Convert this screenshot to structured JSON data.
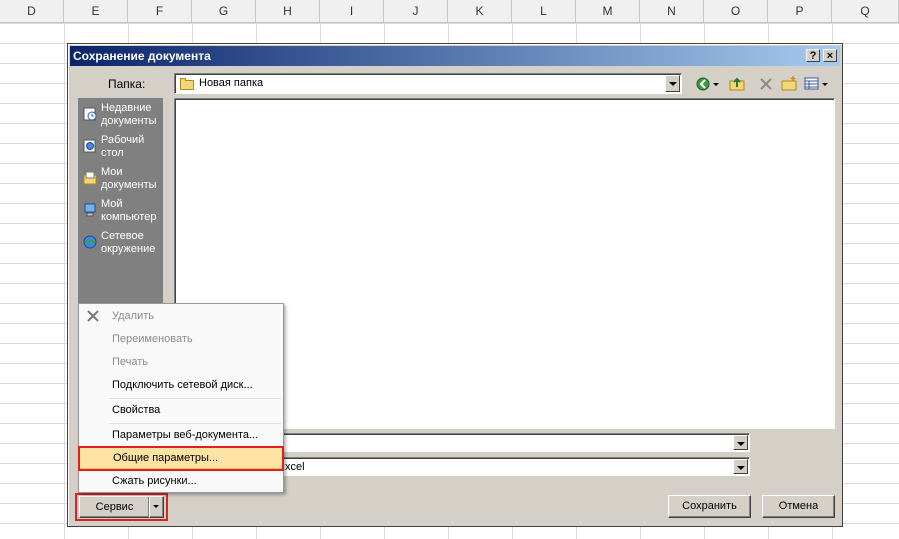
{
  "sheet": {
    "columns": [
      "D",
      "E",
      "F",
      "G",
      "H",
      "I",
      "J",
      "K",
      "L",
      "M",
      "N",
      "O",
      "P",
      "Q"
    ]
  },
  "dialog": {
    "title": "Сохранение документа",
    "help_label": "?",
    "close_label": "×",
    "folder_label": "Папка:",
    "folder_value": "Новая папка",
    "places": [
      {
        "label": "Недавние документы",
        "icon": "recent-docs-icon"
      },
      {
        "label": "Рабочий стол",
        "icon": "desktop-icon"
      },
      {
        "label": "Мои документы",
        "icon": "my-documents-icon"
      },
      {
        "label": "Мой компьютер",
        "icon": "my-computer-icon"
      },
      {
        "label": "Сетевое окружение",
        "icon": "network-icon"
      }
    ],
    "filename_value": "",
    "filetype_value": "xcel",
    "service_label": "Сервис",
    "save_label": "Сохранить",
    "cancel_label": "Отмена"
  },
  "menu": {
    "items": [
      {
        "label": "Удалить",
        "enabled": false
      },
      {
        "label": "Переименовать",
        "enabled": false
      },
      {
        "label": "Печать",
        "enabled": false
      },
      {
        "label": "Подключить сетевой диск...",
        "enabled": true
      },
      {
        "label": "Свойства",
        "enabled": true
      },
      {
        "label": "Параметры веб-документа...",
        "enabled": true
      },
      {
        "label": "Общие параметры...",
        "enabled": true,
        "highlighted": true
      },
      {
        "label": "Сжать рисунки...",
        "enabled": true
      }
    ]
  },
  "colors": {
    "title_start": "#0a246a",
    "title_end": "#a6caf0",
    "highlight_outline": "#e02020",
    "menu_highlight": "#fce2a3"
  }
}
